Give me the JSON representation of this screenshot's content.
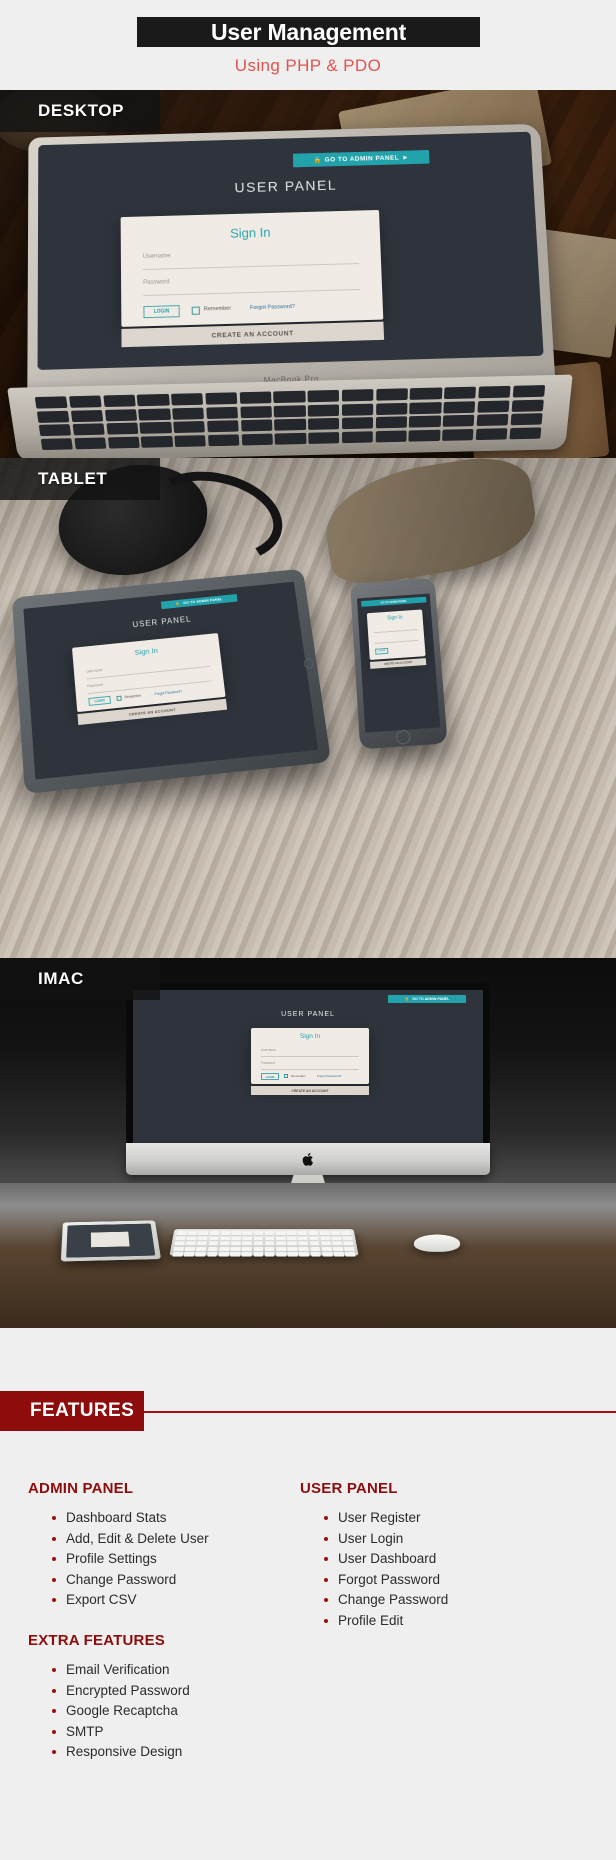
{
  "header": {
    "title": "User Management",
    "subtitle": "Using PHP & PDO"
  },
  "sections": [
    {
      "label": "DESKTOP"
    },
    {
      "label": "TABLET"
    },
    {
      "label": "IMAC"
    }
  ],
  "device_labels": {
    "desktop": "DESKTOP",
    "tablet": "TABLET",
    "imac": "IMAC"
  },
  "laptop": {
    "model_text": "MacBook Pro"
  },
  "app_ui": {
    "admin_button": "GO TO ADMIN PANEL",
    "admin_button_lock_icon": "lock-icon",
    "admin_button_arrow_icon": "arrow-circle-right-icon",
    "panel_title": "USER PANEL",
    "card_title": "Sign In",
    "username_label": "Username",
    "password_label": "Password",
    "login_button": "LOGIN",
    "remember_label": "Remember",
    "forgot_link": "Forgot Password?",
    "create_account": "CREATE AN ACCOUNT"
  },
  "features": {
    "heading": "FEATURES",
    "groups": [
      {
        "title": "ADMIN PANEL",
        "items": [
          "Dashboard Stats",
          "Add, Edit & Delete User",
          "Profile Settings",
          "Change Password",
          "Export CSV"
        ]
      },
      {
        "title": "USER PANEL",
        "items": [
          "User Register",
          "User Login",
          "User Dashboard",
          "Forgot Password",
          "Change Password",
          "Profile Edit"
        ]
      },
      {
        "title": "EXTRA FEATURES",
        "items": [
          "Email Verification",
          "Encrypted Password",
          "Google Recaptcha",
          "SMTP",
          "Responsive Design"
        ]
      }
    ]
  },
  "colors": {
    "accent_red": "#8d0d0d",
    "subtitle_red": "#e0534e",
    "teal": "#22a2ab",
    "screen_bg": "#2f343c",
    "card_bg": "#f0ebe5",
    "page_bg": "#f0efef"
  }
}
